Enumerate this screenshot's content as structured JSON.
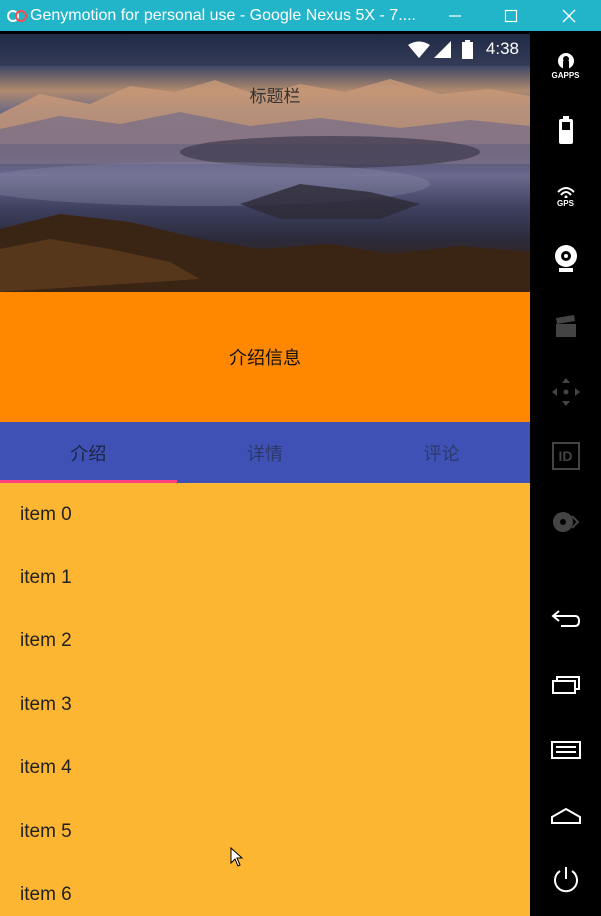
{
  "window": {
    "title": "Genymotion for personal use - Google Nexus 5X - 7....",
    "accent": "#22b4c8"
  },
  "status_bar": {
    "time": "4:38"
  },
  "app": {
    "toolbar_title": "标题栏",
    "intro_text": "介绍信息",
    "tabs": [
      {
        "label": "介绍",
        "selected": true
      },
      {
        "label": "详情",
        "selected": false
      },
      {
        "label": "评论",
        "selected": false
      }
    ],
    "list_items": [
      "item 0",
      "item 1",
      "item 2",
      "item 3",
      "item 4",
      "item 5",
      "item 6"
    ],
    "colors": {
      "intro": "#ff8800",
      "tabs": "#3f51b5",
      "indicator": "#ff4081",
      "list": "#fdb632"
    }
  },
  "sidebar": {
    "gapps_label": "GAPPS",
    "gps_label": "GPS",
    "id_label": "ID",
    "icons": [
      "gapps-icon",
      "battery-icon",
      "gps-icon",
      "camera-icon",
      "capture-icon",
      "dpad-icon",
      "id-icon",
      "disk-icon",
      "back-icon",
      "recent-apps-icon",
      "menu-icon",
      "home-icon",
      "power-icon"
    ]
  }
}
